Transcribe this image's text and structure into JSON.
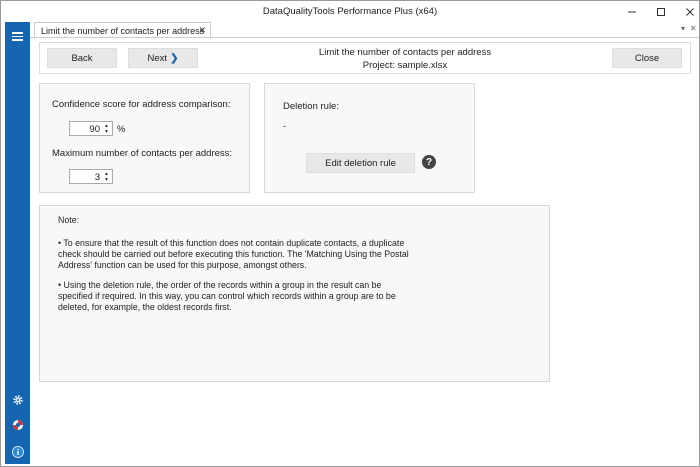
{
  "window": {
    "title": "DataQualityTools Performance Plus (x64)",
    "minimize_icon": "minimize-icon",
    "maximize_icon": "maximize-icon",
    "close_icon": "close-icon"
  },
  "sidebar": {
    "accent": "#1565b0",
    "icons": [
      "menu-icon",
      "gear-icon",
      "lifebuoy-icon",
      "info-icon"
    ]
  },
  "tab": {
    "label": "Limit the number of contacts per address",
    "close_glyph": "✕"
  },
  "header": {
    "back_label": "Back",
    "next_label": "Next",
    "next_arrow": "❯",
    "close_label": "Close",
    "title": "Limit the number of contacts per address",
    "project": "Project: sample.xlsx"
  },
  "settings": {
    "confidence_label": "Confidence score for address comparison:",
    "confidence_value": "90",
    "confidence_unit": "%",
    "max_contacts_label": "Maximum number of contacts per address:",
    "max_contacts_value": "3"
  },
  "deletion": {
    "label": "Deletion rule:",
    "value": "-",
    "edit_label": "Edit deletion rule",
    "help_glyph": "?"
  },
  "note": {
    "heading": "Note:",
    "paragraph1": "• To ensure that the result of this function does not contain duplicate contacts, a duplicate check should be carried out before executing this function. The 'Matching Using the Postal Address' function can be used for this purpose, amongst others.",
    "paragraph2": "• Using the deletion rule, the order of the records within a group in the result can be specified if required. In this way, you can control which records within a group are to be deleted, for example, the oldest records first."
  }
}
